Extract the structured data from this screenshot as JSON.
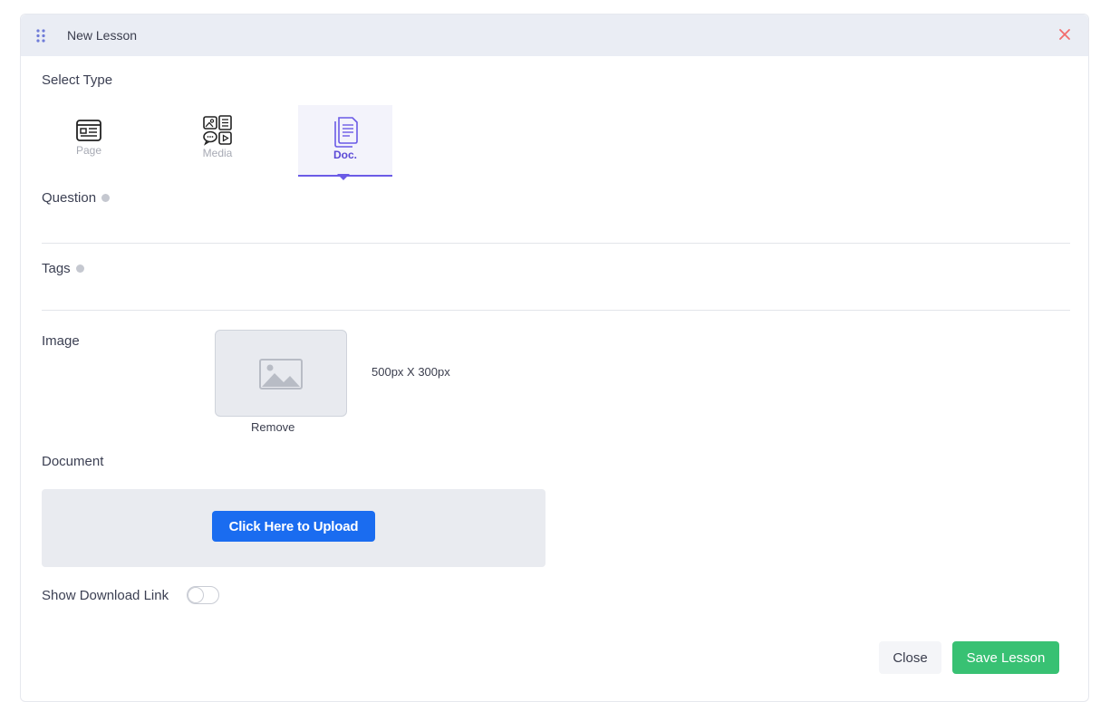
{
  "header": {
    "title": "New Lesson",
    "drag_icon": "drag-handle-icon",
    "close_icon": "close-icon",
    "close_color": "#f26c6c"
  },
  "select_type": {
    "label": "Select Type",
    "options": [
      {
        "label": "Page",
        "icon": "page-icon",
        "active": false
      },
      {
        "label": "Media",
        "icon": "media-icon",
        "active": false
      },
      {
        "label": "Doc.",
        "icon": "document-icon",
        "active": true
      }
    ]
  },
  "question": {
    "label": "Question",
    "value": ""
  },
  "tags": {
    "label": "Tags",
    "value": ""
  },
  "image": {
    "label": "Image",
    "size_hint": "500px X 300px",
    "remove_label": "Remove",
    "placeholder_icon": "image-placeholder-icon"
  },
  "document": {
    "label": "Document",
    "upload_label": "Click Here to Upload"
  },
  "download_link": {
    "label": "Show Download Link",
    "enabled": false
  },
  "footer": {
    "close_label": "Close",
    "save_label": "Save Lesson"
  },
  "colors": {
    "accent": "#6b5be6",
    "upload": "#1a6cf0",
    "save": "#38c173"
  }
}
